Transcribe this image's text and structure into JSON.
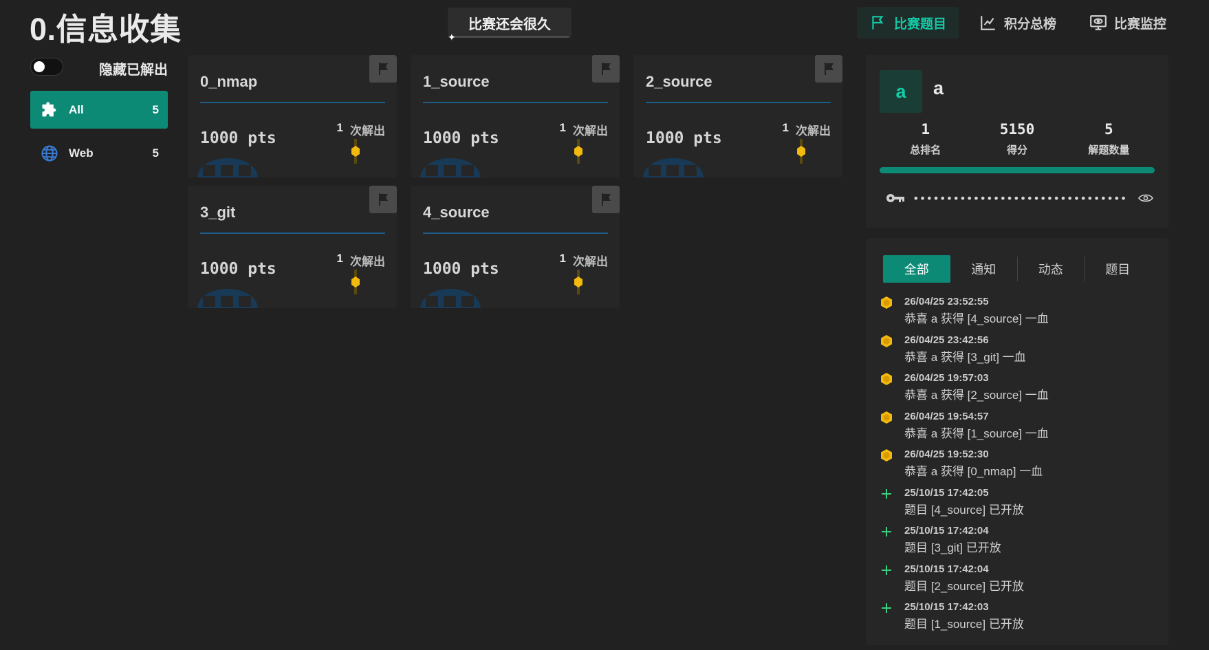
{
  "header": {
    "title": "0.信息收集",
    "status": "比赛还会很久",
    "nav": [
      {
        "label": "比赛题目",
        "icon": "flag-icon",
        "active": true
      },
      {
        "label": "积分总榜",
        "icon": "chart-line-icon",
        "active": false
      },
      {
        "label": "比赛监控",
        "icon": "monitor-eye-icon",
        "active": false
      }
    ]
  },
  "sidebar": {
    "hide_solved_label": "隐藏已解出",
    "hide_solved_on": false,
    "categories": [
      {
        "name": "All",
        "count": "5",
        "icon": "puzzle-icon",
        "active": true
      },
      {
        "name": "Web",
        "count": "5",
        "icon": "globe-icon",
        "active": false
      }
    ]
  },
  "challenges": [
    {
      "name": "0_nmap",
      "points": "1000 pts",
      "solves": "1",
      "solves_label": "次解出"
    },
    {
      "name": "1_source",
      "points": "1000 pts",
      "solves": "1",
      "solves_label": "次解出"
    },
    {
      "name": "2_source",
      "points": "1000 pts",
      "solves": "1",
      "solves_label": "次解出"
    },
    {
      "name": "3_git",
      "points": "1000 pts",
      "solves": "1",
      "solves_label": "次解出"
    },
    {
      "name": "4_source",
      "points": "1000 pts",
      "solves": "1",
      "solves_label": "次解出"
    }
  ],
  "profile": {
    "avatar_letter": "a",
    "username": "a",
    "stats": [
      {
        "value": "1",
        "label": "总排名"
      },
      {
        "value": "5150",
        "label": "得分"
      },
      {
        "value": "5",
        "label": "解题数量"
      }
    ],
    "score_progress": 1.0,
    "token_masked": "••••••••••••••••••••••••••••••••"
  },
  "feed": {
    "tabs": [
      {
        "label": "全部",
        "active": true
      },
      {
        "label": "通知",
        "active": false
      },
      {
        "label": "动态",
        "active": false
      },
      {
        "label": "题目",
        "active": false
      }
    ],
    "items": [
      {
        "type": "blood",
        "time": "26/04/25 23:52:55",
        "text": "恭喜 a 获得 [4_source] 一血"
      },
      {
        "type": "blood",
        "time": "26/04/25 23:42:56",
        "text": "恭喜 a 获得 [3_git] 一血"
      },
      {
        "type": "blood",
        "time": "26/04/25 19:57:03",
        "text": "恭喜 a 获得 [2_source] 一血"
      },
      {
        "type": "blood",
        "time": "26/04/25 19:54:57",
        "text": "恭喜 a 获得 [1_source] 一血"
      },
      {
        "type": "blood",
        "time": "26/04/25 19:52:30",
        "text": "恭喜 a 获得 [0_nmap] 一血"
      },
      {
        "type": "new",
        "time": "25/10/15 17:42:05",
        "text": "题目 [4_source] 已开放"
      },
      {
        "type": "new",
        "time": "25/10/15 17:42:04",
        "text": "题目 [3_git] 已开放"
      },
      {
        "type": "new",
        "time": "25/10/15 17:42:04",
        "text": "题目 [2_source] 已开放"
      },
      {
        "type": "new",
        "time": "25/10/15 17:42:03",
        "text": "题目 [1_source] 已开放"
      }
    ]
  },
  "colors": {
    "accent": "#0d8a76",
    "accent_text": "#14c9a6",
    "gold": "#f2b90f",
    "card_line": "#1d5d88",
    "background": "#212121",
    "panel": "#262626"
  }
}
